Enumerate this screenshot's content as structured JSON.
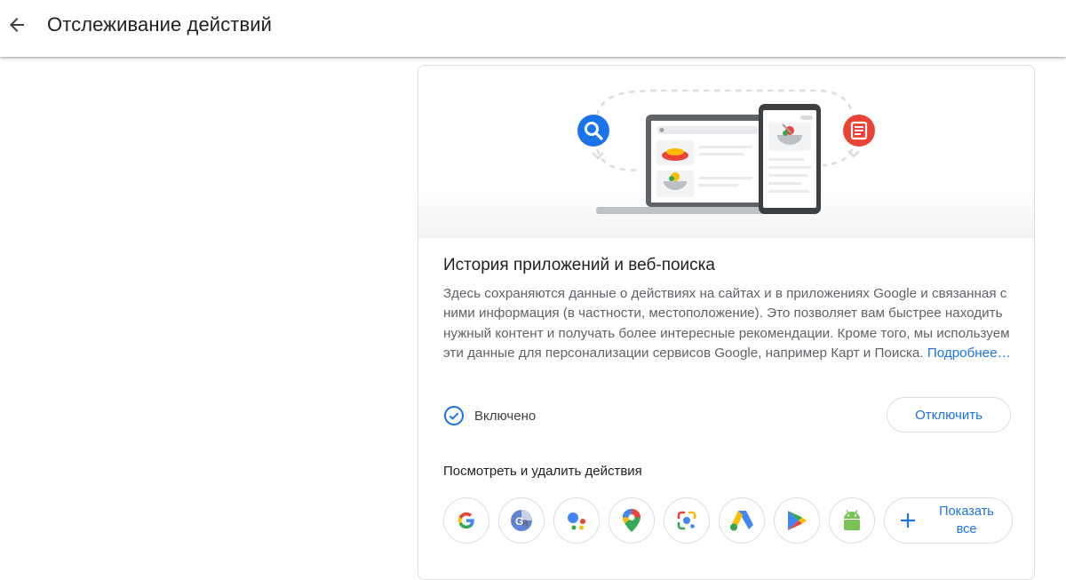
{
  "header": {
    "back_icon": "arrow-back-icon",
    "title": "Отслеживание действий"
  },
  "card": {
    "hero_icons": [
      "search-icon",
      "laptop-icon",
      "phone-icon",
      "document-icon"
    ],
    "title": "История приложений и веб-поиска",
    "description": "Здесь сохраняются данные о действиях на сайтах и в приложениях Google и связанная с ними информация (в частности, местоположение). Это позволяет вам быстрее находить нужный контент и получать более интересные рекомендации. Кроме того, мы используем эти данные для персонализации сервисов Google, например Карт и Поиска.",
    "learn_more": "Подробнее…",
    "status": {
      "icon": "check-circle-icon",
      "label": "Включено"
    },
    "toggle_button": "Отключить",
    "activity_section": {
      "title": "Посмотреть и удалить действия",
      "apps": [
        {
          "name": "google-search-icon"
        },
        {
          "name": "google-translate-icon"
        },
        {
          "name": "google-assistant-icon"
        },
        {
          "name": "google-maps-icon"
        },
        {
          "name": "google-lens-icon"
        },
        {
          "name": "google-ads-icon"
        },
        {
          "name": "google-play-icon"
        },
        {
          "name": "android-icon"
        }
      ],
      "show_all_label": "Показать все",
      "show_all_icon": "plus-icon"
    }
  },
  "colors": {
    "accent": "#1a73e8",
    "text_primary": "#202124",
    "text_secondary": "#5f6368",
    "border": "#dadce0"
  }
}
